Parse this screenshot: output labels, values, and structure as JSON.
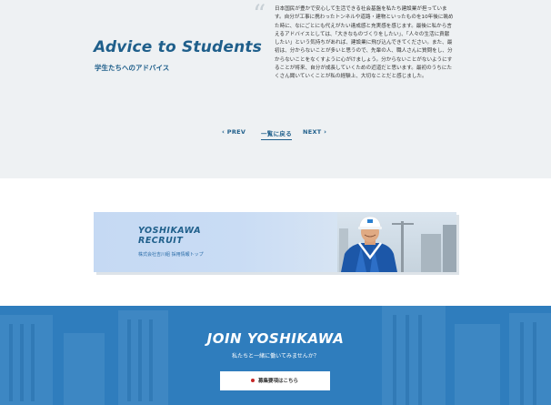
{
  "advice": {
    "title": "Advice to Students",
    "subtitle": "学生たちへのアドバイス",
    "quote_mark": "“",
    "body": "日本国民が豊かで安心して生活できる社会基盤を私たち建設業が担っています。自分が工事に携わったトンネルや道路・建物といったものを10年後に眺めた時に、なにごとにも代えがたい達成感と充実感を感じます。最後に私から言えるアドバイスとしては、「大きなものづくりをしたい」、「人々の生活に貢献したい」という気持ちがあれば、建設業に飛び込んできてください。また、最初は、分からないことが多いと思うので、先輩の人、職人さんに質問をし、分からないことをなくすように心がけましょう。分からないことがないようにすることが将来、自分が成長していくための近道だと思います。最初のうちにたくさん聞いていくことが私の経験上、大切なことだと感じました。"
  },
  "pager": {
    "prev_label": "PREV",
    "list_label": "一覧に戻る",
    "next_label": "NEXT"
  },
  "recruit_banner": {
    "title": "YOSHIKAWA\nRECRUIT",
    "subtitle": "株式会社吉川組 採用情報トップ"
  },
  "join": {
    "title": "JOIN YOSHIKAWA",
    "subtitle": "私たちと一緒に働いてみませんか？",
    "button_label": "募集要項はこちら"
  },
  "colors": {
    "brand_blue": "#1f5f8b",
    "join_background": "#2f7dbd",
    "button_dot": "#c62828"
  }
}
